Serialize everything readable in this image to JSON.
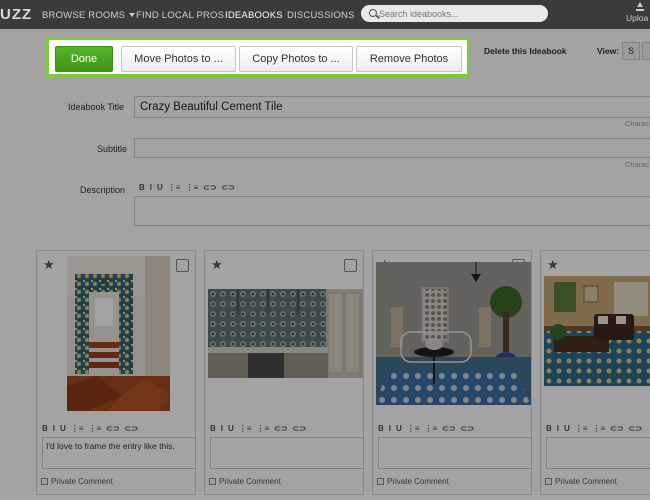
{
  "nav": {
    "logo": "UZZ",
    "items": [
      "BROWSE ROOMS",
      "FIND LOCAL PROS",
      "IDEABOOKS",
      "DISCUSSIONS"
    ],
    "search_placeholder": "Search ideabooks...",
    "upload_label": "Uploa"
  },
  "action_bar": {
    "done": "Done",
    "move": "Move Photos to ...",
    "copy": "Copy Photos to ...",
    "remove": "Remove Photos"
  },
  "toolbar": {
    "delete": "Delete this Ideabook",
    "view_label": "View:",
    "view_s": "S"
  },
  "form": {
    "title_label": "Ideabook Title",
    "title_value": "Crazy Beautiful Cement Tile",
    "char_note_1": "Charac",
    "subtitle_label": "Subtitle",
    "char_note_2": "Charac",
    "description_label": "Description"
  },
  "rte": [
    "B",
    "I",
    "U",
    "⋮≡",
    "⋮≡",
    "⊂⊃",
    "⊂⊃"
  ],
  "cards": [
    {
      "comment": "I'd love to frame the entry like this.",
      "private_label": "Private Comment"
    },
    {
      "comment": "",
      "private_label": "Private Comment"
    },
    {
      "comment": "",
      "private_label": "Private Comment"
    },
    {
      "comment": "",
      "private_label": "Private Comment"
    }
  ],
  "colors": {
    "nav_bg": "#3b3b3b",
    "done_green": "#4aa31f",
    "highlight_border": "#7ccb3a"
  }
}
